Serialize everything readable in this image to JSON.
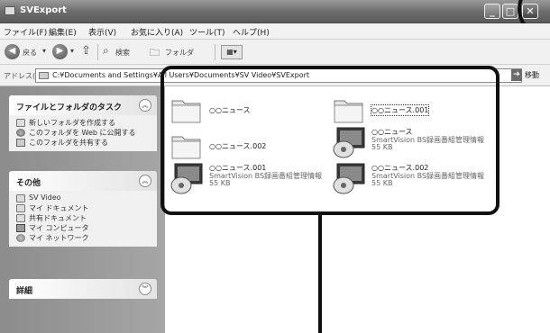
{
  "window": {
    "title": "SVExport",
    "buttons": {
      "minimize": "_",
      "maximize": "□",
      "close": "✕"
    }
  },
  "menu": [
    "ファイル(F)",
    "編集(E)",
    "表示(V)",
    "お気に入り(A)",
    "ツール(T)",
    "ヘルプ(H)"
  ],
  "toolbar": {
    "back": "戻る",
    "search": "検索",
    "folders": "フォルダ",
    "view": "▦▾"
  },
  "address": {
    "label": "アドレス(D)",
    "path": "C:¥Documents and Settings¥All Users¥Documents¥SV Video¥SVExport",
    "go_label": "移動"
  },
  "taskpane": {
    "tasks": {
      "title": "ファイルとフォルダのタスク",
      "items": [
        "新しいフォルダを作成する",
        "このフォルダを Web に公開する",
        "このフォルダを共有する"
      ]
    },
    "other": {
      "title": "その他",
      "items": [
        "SV Video",
        "マイ ドキュメント",
        "共有ドキュメント",
        "マイ コンピュータ",
        "マイ ネットワーク"
      ]
    },
    "details": {
      "title": "詳細"
    }
  },
  "files": [
    {
      "name": "○○ニュース",
      "type": "folder"
    },
    {
      "name": "○○ニュース.001",
      "type": "folder",
      "selected": true
    },
    {
      "name": "○○ニュース.002",
      "type": "folder"
    },
    {
      "name": "○○ニュース",
      "type": "recording",
      "desc": "SmartVision BS録画番組管理情報",
      "size": "55 KB"
    },
    {
      "name": "○○ニュース.001",
      "type": "recording",
      "desc": "SmartVision BS録画番組管理情報",
      "size": "55 KB"
    },
    {
      "name": "○○ニュース.002",
      "type": "recording",
      "desc": "SmartVision BS録画番組管理情報",
      "size": "55 KB"
    }
  ]
}
